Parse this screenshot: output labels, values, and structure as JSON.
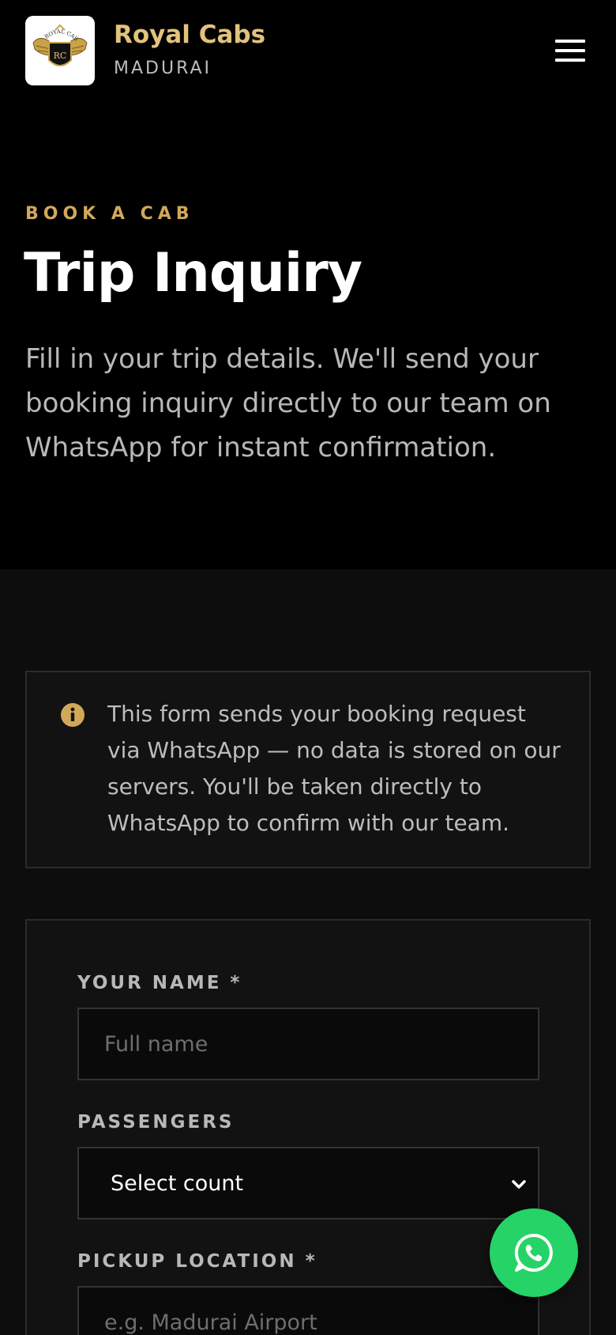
{
  "header": {
    "brand_name": "Royal Cabs",
    "brand_city": "MADURAI",
    "logo_text": "ROYAL CABS",
    "logo_initials": "RC",
    "menu_icon": "hamburger-menu-icon"
  },
  "hero": {
    "eyebrow": "BOOK A CAB",
    "title": "Trip Inquiry",
    "description": "Fill in your trip details. We'll send your booking inquiry directly to our team on WhatsApp for instant confirmation."
  },
  "notice": {
    "icon": "info-icon",
    "text": "This form sends your booking request via WhatsApp — no data is stored on our servers. You'll be taken directly to WhatsApp to confirm with our team."
  },
  "form": {
    "name_label": "YOUR NAME *",
    "name_placeholder": "Full name",
    "passengers_label": "PASSENGERS",
    "passengers_value": "Select count",
    "pickup_label": "PICKUP LOCATION *",
    "pickup_placeholder": "e.g. Madurai Airport"
  },
  "whatsapp_button": {
    "icon": "whatsapp-icon"
  },
  "colors": {
    "accent_gold": "#d1a85a",
    "brand_gold": "#e2c27d",
    "whatsapp_green": "#25d366",
    "background": "#000000",
    "section_bg": "#0d0d0d"
  }
}
